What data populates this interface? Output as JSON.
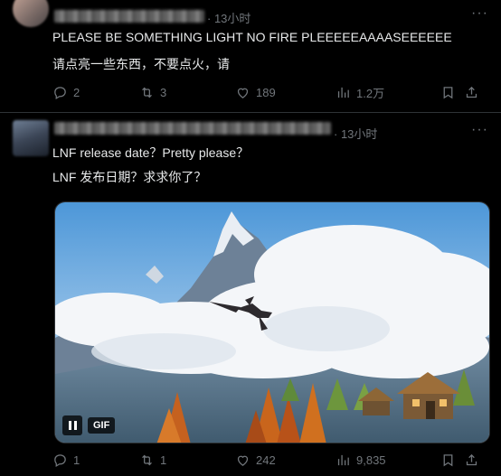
{
  "tweets": [
    {
      "time": "· 13小时",
      "text_en": "PLEASE BE SOMETHING LIGHT NO FIRE PLEEEEEAAAASEEEEEE",
      "text_zh": "请点亮一些东西，不要点火，请",
      "replies": "2",
      "retweets": "3",
      "likes": "189",
      "views": "1.2万"
    },
    {
      "time": "· 13小时",
      "text_en": "LNF release date？Pretty please？",
      "text_zh": "LNF 发布日期？求求你了？",
      "media_badge": "GIF",
      "replies": "1",
      "retweets": "1",
      "likes": "242",
      "views": "9,835"
    }
  ],
  "icons": [
    "more-icon",
    "reply-icon",
    "retweet-icon",
    "like-icon",
    "views-icon",
    "bookmark-icon",
    "share-icon",
    "pause-icon"
  ],
  "colors": {
    "background": "#000000",
    "text": "#e7e9ea",
    "muted": "#71767b",
    "divider": "#2f3336"
  }
}
